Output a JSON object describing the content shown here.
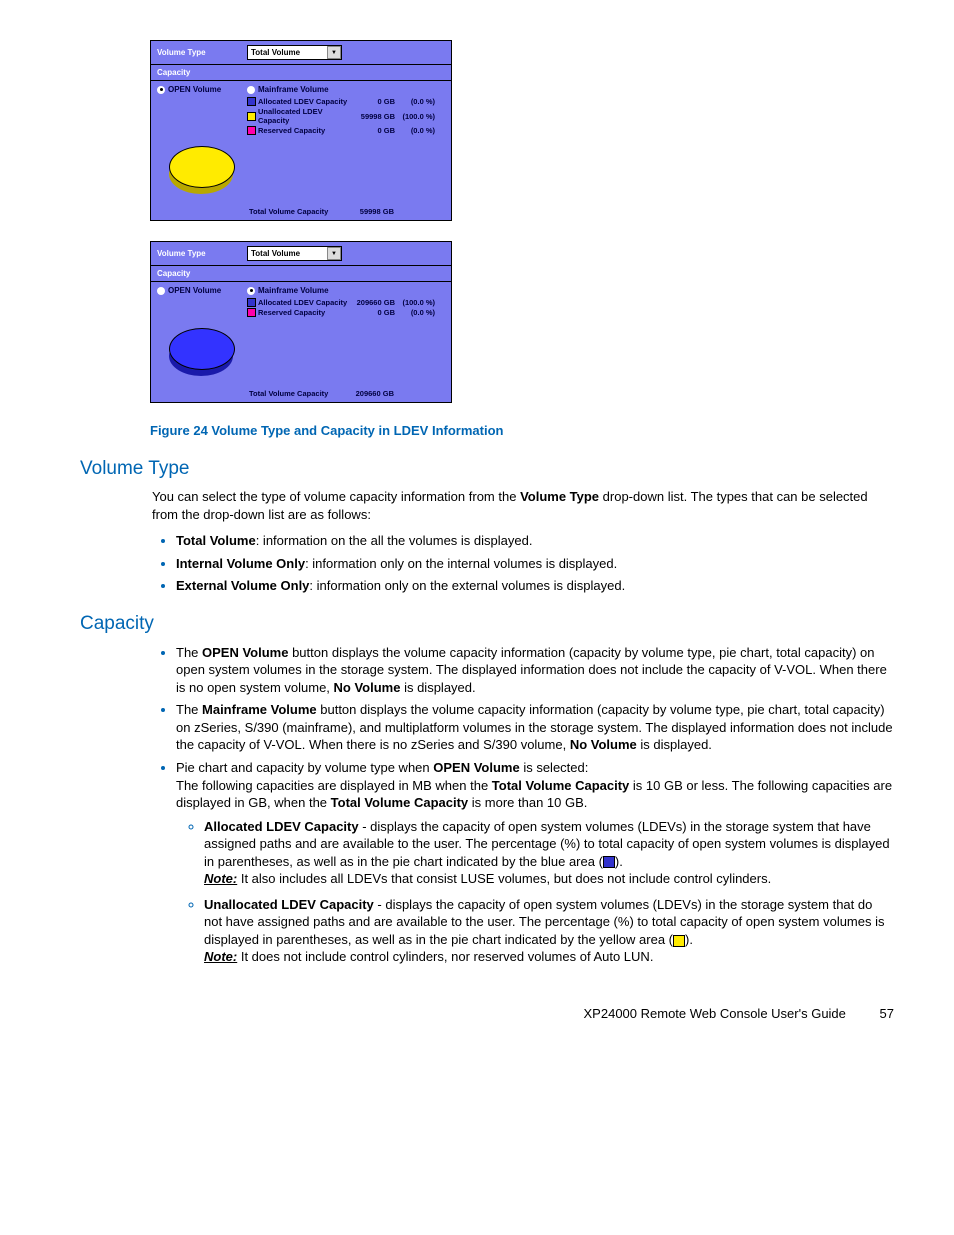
{
  "panel1": {
    "volumeTypeLabel": "Volume Type",
    "selectValue": "Total Volume",
    "capacityLabel": "Capacity",
    "radioOpen": "OPEN Volume",
    "radioMainframe": "Mainframe Volume",
    "rows": [
      {
        "label": "Allocated LDEV Capacity",
        "val": "0 GB",
        "pct": "(0.0 %)",
        "color": "#3333cc"
      },
      {
        "label": "Unallocated LDEV Capacity",
        "val": "59998 GB",
        "pct": "(100.0 %)",
        "color": "#ffeb00"
      },
      {
        "label": "Reserved Capacity",
        "val": "0 GB",
        "pct": "(0.0 %)",
        "color": "#ff00aa"
      }
    ],
    "totalLabel": "Total Volume Capacity",
    "totalVal": "59998 GB",
    "pieTop": "#ffeb00",
    "pieBase": "#b8a800"
  },
  "panel2": {
    "volumeTypeLabel": "Volume Type",
    "selectValue": "Total Volume",
    "capacityLabel": "Capacity",
    "radioOpen": "OPEN Volume",
    "radioMainframe": "Mainframe Volume",
    "rows": [
      {
        "label": "Allocated LDEV Capacity",
        "val": "209660 GB",
        "pct": "(100.0 %)",
        "color": "#3333cc"
      },
      {
        "label": "Reserved Capacity",
        "val": "0 GB",
        "pct": "(0.0 %)",
        "color": "#ff00aa"
      }
    ],
    "totalLabel": "Total Volume Capacity",
    "totalVal": "209660 GB",
    "pieTop": "#3333ff",
    "pieBase": "#1a1aaa"
  },
  "figureCaption": "Figure 24 Volume Type and Capacity in LDEV Information",
  "volTypeHeading": "Volume Type",
  "volTypeIntro1": "You can select the type of volume capacity information from the ",
  "volTypeIntroBold": "Volume Type",
  "volTypeIntro2": " drop-down list. The types that can be selected from the drop-down list are as follows:",
  "volBullets": [
    {
      "b": "Total Volume",
      "t": ": information on the all the volumes is displayed."
    },
    {
      "b": "Internal Volume Only",
      "t": ": information only on the internal volumes is displayed."
    },
    {
      "b": "External Volume Only",
      "t": ": information only on the external volumes is displayed."
    }
  ],
  "capHeading": "Capacity",
  "capB1_p1": "The ",
  "capB1_b1": "OPEN Volume",
  "capB1_p2": " button displays the volume capacity information (capacity by volume type, pie chart, total capacity) on open system volumes in the storage system. The displayed information does not include the capacity of V-VOL. When there is no open system volume, ",
  "capB1_b2": "No Volume",
  "capB1_p3": " is displayed.",
  "capB2_p1": "The ",
  "capB2_b1": "Mainframe Volume",
  "capB2_p2": " button displays the volume capacity information (capacity by volume type, pie chart, total capacity) on zSeries, S/390 (mainframe), and multiplatform volumes in the storage system. The displayed information does not include the capacity of V-VOL. When there is no zSeries and S/390 volume, ",
  "capB2_b2": "No Volume",
  "capB2_p3": " is displayed.",
  "capB3_p1": "Pie chart and capacity by volume type when ",
  "capB3_b1": "OPEN Volume",
  "capB3_p2": " is selected:",
  "capB3_p3": "The following capacities are displayed in MB when the ",
  "capB3_b2": "Total Volume Capacity",
  "capB3_p4": " is 10 GB or less. The following capacities are displayed in GB, when the ",
  "capB3_b3": "Total Volume Capacity",
  "capB3_p5": " is more than 10 GB.",
  "sub1_b": "Allocated LDEV Capacity",
  "sub1_t1": " - displays the capacity of open system volumes (LDEVs) in the storage system that have assigned paths and are available to the user. The percentage (%) to total capacity of open system volumes is displayed in parentheses, as well as in the pie chart indicated by the blue area (",
  "sub1_t2": ").",
  "sub1_nb": "Note:",
  "sub1_nt": " It also includes all LDEVs that consist LUSE volumes, but does not include control cylinders.",
  "sub2_b": "Unallocated LDEV Capacity",
  "sub2_t1": " - displays the capacity of open system volumes (LDEVs) in the storage system that do not have assigned paths and are available to the user. The percentage (%) to total capacity of open system volumes is displayed in parentheses, as well as in the pie chart indicated by the yellow area (",
  "sub2_t2": ").",
  "sub2_nb": "Note:",
  "sub2_nt": " It does not include control cylinders, nor reserved volumes of Auto LUN.",
  "footerText": "XP24000 Remote Web Console User's Guide",
  "footerPage": "57",
  "chart_data": [
    {
      "type": "pie",
      "title": "OPEN Volume - Total Volume Capacity",
      "series": [
        {
          "name": "Allocated LDEV Capacity",
          "value": 0,
          "pct": 0.0,
          "color": "#3333cc"
        },
        {
          "name": "Unallocated LDEV Capacity",
          "value": 59998,
          "pct": 100.0,
          "color": "#ffeb00"
        },
        {
          "name": "Reserved Capacity",
          "value": 0,
          "pct": 0.0,
          "color": "#ff00aa"
        }
      ],
      "total": 59998,
      "unit": "GB"
    },
    {
      "type": "pie",
      "title": "Mainframe Volume - Total Volume Capacity",
      "series": [
        {
          "name": "Allocated LDEV Capacity",
          "value": 209660,
          "pct": 100.0,
          "color": "#3333cc"
        },
        {
          "name": "Reserved Capacity",
          "value": 0,
          "pct": 0.0,
          "color": "#ff00aa"
        }
      ],
      "total": 209660,
      "unit": "GB"
    }
  ]
}
